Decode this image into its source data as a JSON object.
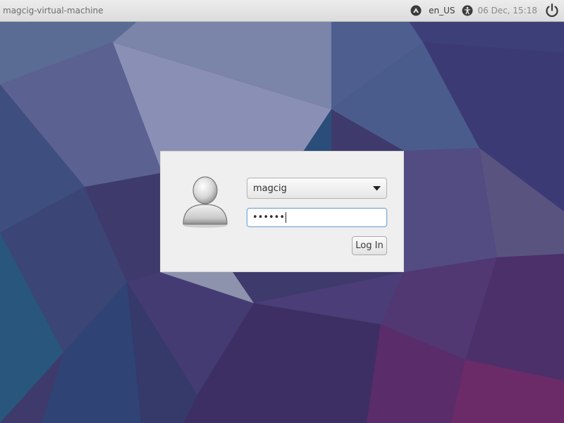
{
  "top_panel": {
    "hostname": "magcig-virtual-machine",
    "indicators": [
      {
        "icon": "network-icon"
      },
      {
        "label": "en_US"
      },
      {
        "icon": "accessibility-icon"
      },
      {
        "icon": "power-icon"
      }
    ],
    "keyboard_layout": "en_US",
    "clock": "06 Dec, 15:18"
  },
  "login": {
    "avatar_icon": "user-avatar-icon",
    "username": "magcig",
    "password_masked": "••••••",
    "login_button_label": "Log In"
  },
  "colors": {
    "panel_bg": "#e0e0e0",
    "dialog_bg": "#efefef",
    "focus_border": "#7fa8d2",
    "wallpaper_primary": "#3f3b6f",
    "wallpaper_accent": "#6a2f6e"
  }
}
